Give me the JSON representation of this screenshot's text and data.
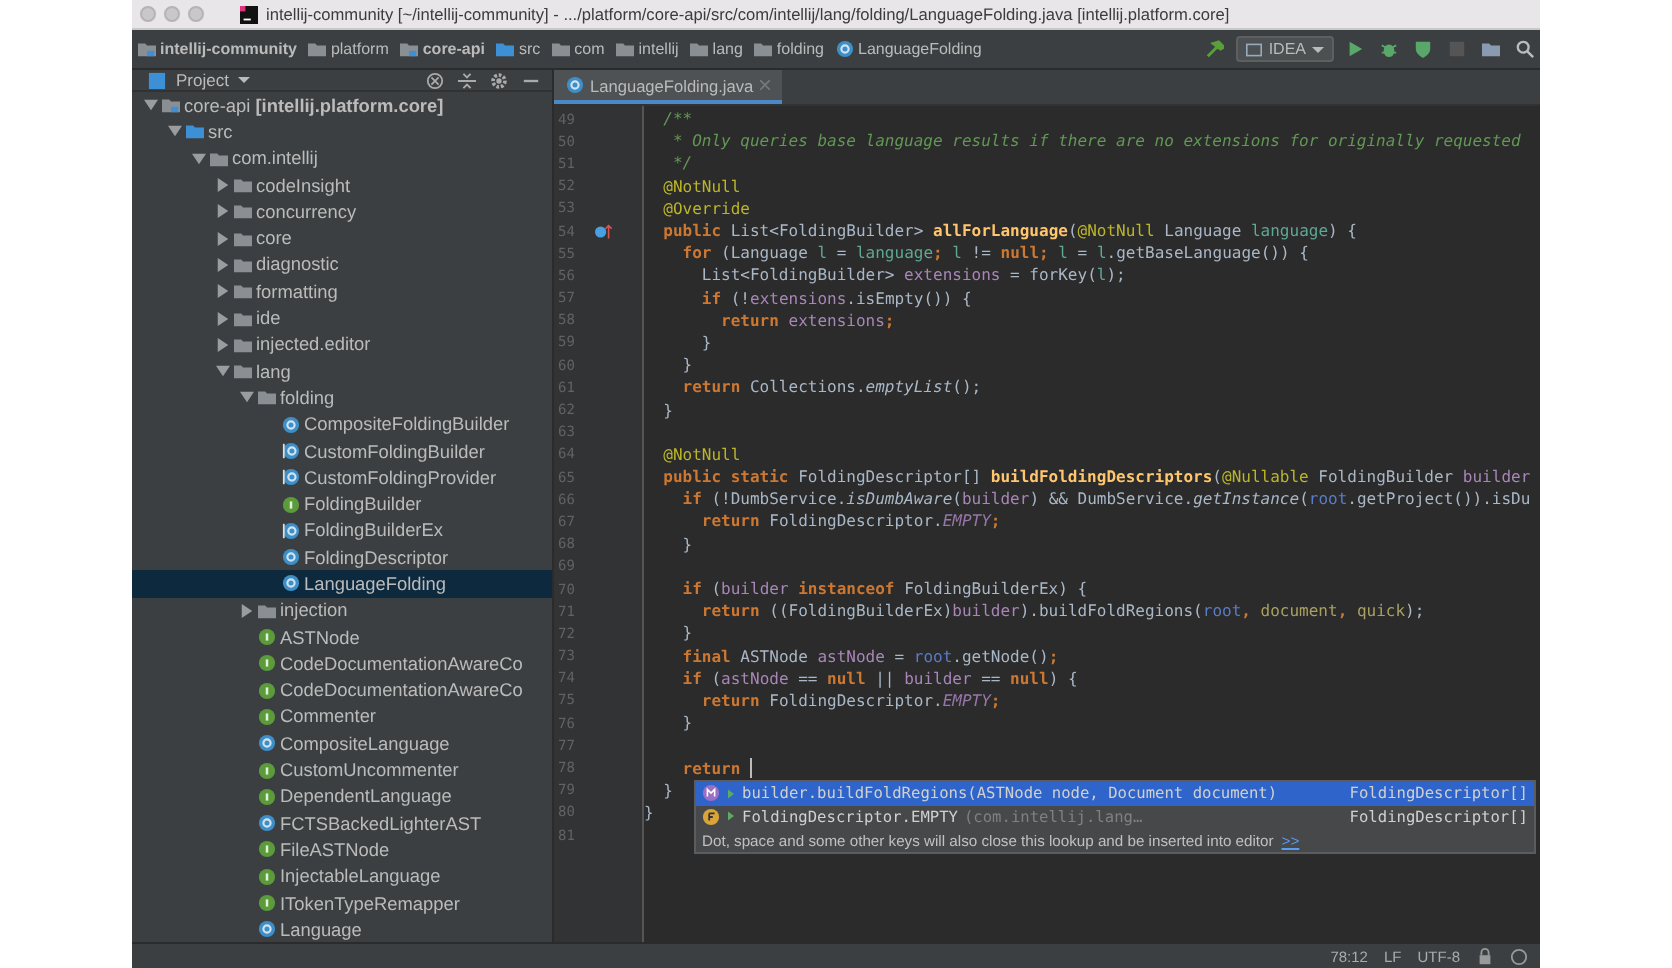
{
  "window": {
    "title": "intellij-community [~/intellij-community] - .../platform/core-api/src/com/intellij/lang/folding/LanguageFolding.java [intellij.platform.core]"
  },
  "breadcrumbs": [
    {
      "label": "intellij-community",
      "kind": "module"
    },
    {
      "label": "platform",
      "kind": "folder"
    },
    {
      "label": "core-api",
      "kind": "module"
    },
    {
      "label": "src",
      "kind": "source"
    },
    {
      "label": "com",
      "kind": "folder"
    },
    {
      "label": "intellij",
      "kind": "folder"
    },
    {
      "label": "lang",
      "kind": "folder"
    },
    {
      "label": "folding",
      "kind": "folder"
    },
    {
      "label": "LanguageFolding",
      "kind": "class"
    }
  ],
  "run_config": {
    "label": "IDEA"
  },
  "project_panel": {
    "title": "Project"
  },
  "tree": [
    {
      "label": "core-api **[intellij.platform.core]**",
      "kind": "module",
      "expanded": true,
      "selected": false,
      "children": [
        {
          "label": "src",
          "kind": "source",
          "expanded": true,
          "selected": false,
          "children": [
            {
              "label": "com.intellij",
              "kind": "folder",
              "expanded": true,
              "selected": false,
              "children": [
                {
                  "label": "codeInsight",
                  "kind": "folder",
                  "expanded": false,
                  "selected": false
                },
                {
                  "label": "concurrency",
                  "kind": "folder",
                  "expanded": false,
                  "selected": false
                },
                {
                  "label": "core",
                  "kind": "folder",
                  "expanded": false,
                  "selected": false
                },
                {
                  "label": "diagnostic",
                  "kind": "folder",
                  "expanded": false,
                  "selected": false
                },
                {
                  "label": "formatting",
                  "kind": "folder",
                  "expanded": false,
                  "selected": false
                },
                {
                  "label": "ide",
                  "kind": "folder",
                  "expanded": false,
                  "selected": false
                },
                {
                  "label": "injected.editor",
                  "kind": "folder",
                  "expanded": false,
                  "selected": false
                },
                {
                  "label": "lang",
                  "kind": "folder",
                  "expanded": true,
                  "selected": false,
                  "children": [
                    {
                      "label": "folding",
                      "kind": "folder",
                      "expanded": true,
                      "selected": false,
                      "children": [
                        {
                          "label": "CompositeFoldingBuilder",
                          "kind": "class",
                          "selected": false
                        },
                        {
                          "label": "CustomFoldingBuilder",
                          "kind": "abstract",
                          "selected": false
                        },
                        {
                          "label": "CustomFoldingProvider",
                          "kind": "abstract",
                          "selected": false
                        },
                        {
                          "label": "FoldingBuilder",
                          "kind": "interface",
                          "selected": false
                        },
                        {
                          "label": "FoldingBuilderEx",
                          "kind": "abstract",
                          "selected": false
                        },
                        {
                          "label": "FoldingDescriptor",
                          "kind": "class",
                          "selected": false
                        },
                        {
                          "label": "LanguageFolding",
                          "kind": "class",
                          "selected": true
                        }
                      ]
                    },
                    {
                      "label": "injection",
                      "kind": "folder",
                      "expanded": false,
                      "selected": false
                    },
                    {
                      "label": "ASTNode",
                      "kind": "interface",
                      "selected": false
                    },
                    {
                      "label": "CodeDocumentationAwareCo",
                      "kind": "interface",
                      "selected": false
                    },
                    {
                      "label": "CodeDocumentationAwareCo",
                      "kind": "interface",
                      "selected": false
                    },
                    {
                      "label": "Commenter",
                      "kind": "interface",
                      "selected": false
                    },
                    {
                      "label": "CompositeLanguage",
                      "kind": "class",
                      "selected": false
                    },
                    {
                      "label": "CustomUncommenter",
                      "kind": "interface",
                      "selected": false
                    },
                    {
                      "label": "DependentLanguage",
                      "kind": "interface",
                      "selected": false
                    },
                    {
                      "label": "FCTSBackedLighterAST",
                      "kind": "class",
                      "selected": false
                    },
                    {
                      "label": "FileASTNode",
                      "kind": "interface",
                      "selected": false
                    },
                    {
                      "label": "InjectableLanguage",
                      "kind": "interface",
                      "selected": false
                    },
                    {
                      "label": "ITokenTypeRemapper",
                      "kind": "interface",
                      "selected": false
                    },
                    {
                      "label": "Language",
                      "kind": "class",
                      "selected": false
                    }
                  ]
                }
              ]
            }
          ]
        }
      ]
    }
  ],
  "editor_tab": {
    "label": "LanguageFolding.java",
    "selected": true
  },
  "code": [
    {
      "n": "49",
      "segs": [
        {
          "kind": "cmt",
          "text": "  /**"
        }
      ]
    },
    {
      "n": "50",
      "segs": [
        {
          "kind": "cmt",
          "text": "   * Only queries base language results if there are no extensions for originally requested"
        }
      ]
    },
    {
      "n": "51",
      "segs": [
        {
          "kind": "cmt",
          "text": "   */"
        }
      ]
    },
    {
      "n": "52",
      "segs": [
        {
          "kind": "ann",
          "text": "  @NotNull"
        }
      ]
    },
    {
      "n": "53",
      "segs": [
        {
          "kind": "ann",
          "text": "  @Override"
        }
      ]
    },
    {
      "n": "54",
      "marker": {
        "kind": "override"
      },
      "segs": [
        {
          "kind": "kw",
          "text": "  public "
        },
        {
          "kind": "p",
          "text": "List<FoldingBuilder> "
        },
        {
          "kind": "fn",
          "text": "allForLanguage"
        },
        {
          "kind": "p",
          "text": "("
        },
        {
          "kind": "ann",
          "text": "@NotNull"
        },
        {
          "kind": "p",
          "text": " Language "
        },
        {
          "kind": "var",
          "text": "language"
        },
        {
          "kind": "p",
          "text": ") {"
        }
      ]
    },
    {
      "n": "55",
      "segs": [
        {
          "kind": "kw",
          "text": "    for "
        },
        {
          "kind": "p",
          "text": "(Language "
        },
        {
          "kind": "var",
          "text": "l"
        },
        {
          "kind": "p",
          "text": " = "
        },
        {
          "kind": "var",
          "text": "language"
        },
        {
          "kind": "kw",
          "text": "; "
        },
        {
          "kind": "var",
          "text": "l"
        },
        {
          "kind": "p",
          "text": " != "
        },
        {
          "kind": "kw",
          "text": "null; "
        },
        {
          "kind": "var",
          "text": "l"
        },
        {
          "kind": "p",
          "text": " = "
        },
        {
          "kind": "var",
          "text": "l"
        },
        {
          "kind": "p",
          "text": ".getBaseLanguage()) {"
        }
      ]
    },
    {
      "n": "56",
      "segs": [
        {
          "kind": "p",
          "text": "      List<FoldingBuilder> "
        },
        {
          "kind": "loc",
          "text": "extensions"
        },
        {
          "kind": "p",
          "text": " = forKey("
        },
        {
          "kind": "var",
          "text": "l"
        },
        {
          "kind": "p",
          "text": ");"
        }
      ]
    },
    {
      "n": "57",
      "segs": [
        {
          "kind": "kw",
          "text": "      if "
        },
        {
          "kind": "p",
          "text": "(!"
        },
        {
          "kind": "loc",
          "text": "extensions"
        },
        {
          "kind": "p",
          "text": ".isEmpty()) {"
        }
      ]
    },
    {
      "n": "58",
      "segs": [
        {
          "kind": "kw",
          "text": "        return "
        },
        {
          "kind": "loc",
          "text": "extensions"
        },
        {
          "kind": "kw",
          "text": ";"
        }
      ]
    },
    {
      "n": "59",
      "segs": [
        {
          "kind": "p",
          "text": "      }"
        }
      ]
    },
    {
      "n": "60",
      "segs": [
        {
          "kind": "p",
          "text": "    }"
        }
      ]
    },
    {
      "n": "61",
      "segs": [
        {
          "kind": "kw",
          "text": "    return "
        },
        {
          "kind": "p",
          "text": "Collections."
        },
        {
          "kind": "st",
          "text": "emptyList"
        },
        {
          "kind": "p",
          "text": "();"
        }
      ]
    },
    {
      "n": "62",
      "segs": [
        {
          "kind": "p",
          "text": "  }"
        }
      ]
    },
    {
      "n": "63"
    },
    {
      "n": "64",
      "segs": [
        {
          "kind": "ann",
          "text": "  @NotNull"
        }
      ]
    },
    {
      "n": "65",
      "segs": [
        {
          "kind": "kw",
          "text": "  public static "
        },
        {
          "kind": "p",
          "text": "FoldingDescriptor[] "
        },
        {
          "kind": "fn",
          "text": "buildFoldingDescriptors"
        },
        {
          "kind": "p",
          "text": "("
        },
        {
          "kind": "ann",
          "text": "@Nullable"
        },
        {
          "kind": "p",
          "text": " FoldingBuilder "
        },
        {
          "kind": "loc",
          "text": "builder"
        }
      ]
    },
    {
      "n": "66",
      "segs": [
        {
          "kind": "kw",
          "text": "    if "
        },
        {
          "kind": "p",
          "text": "(!DumbService."
        },
        {
          "kind": "st",
          "text": "isDumbAware"
        },
        {
          "kind": "p",
          "text": "("
        },
        {
          "kind": "loc",
          "text": "builder"
        },
        {
          "kind": "p",
          "text": ") && DumbService."
        },
        {
          "kind": "st",
          "text": "getInstance"
        },
        {
          "kind": "p",
          "text": "("
        },
        {
          "kind": "fld",
          "text": "root"
        },
        {
          "kind": "p",
          "text": ".getProject()).isDu"
        }
      ]
    },
    {
      "n": "67",
      "segs": [
        {
          "kind": "kw",
          "text": "      return "
        },
        {
          "kind": "p",
          "text": "FoldingDescriptor."
        },
        {
          "kind": "const",
          "text": "EMPTY"
        },
        {
          "kind": "kw",
          "text": ";"
        }
      ]
    },
    {
      "n": "68",
      "segs": [
        {
          "kind": "p",
          "text": "    }"
        }
      ]
    },
    {
      "n": "69"
    },
    {
      "n": "70",
      "segs": [
        {
          "kind": "kw",
          "text": "    if "
        },
        {
          "kind": "p",
          "text": "("
        },
        {
          "kind": "loc",
          "text": "builder"
        },
        {
          "kind": "kw",
          "text": " instanceof "
        },
        {
          "kind": "p",
          "text": "FoldingBuilderEx) {"
        }
      ]
    },
    {
      "n": "71",
      "segs": [
        {
          "kind": "kw",
          "text": "      return "
        },
        {
          "kind": "p",
          "text": "((FoldingBuilderEx)"
        },
        {
          "kind": "loc",
          "text": "builder"
        },
        {
          "kind": "p",
          "text": ").buildFoldRegions("
        },
        {
          "kind": "fld",
          "text": "root"
        },
        {
          "kind": "kw",
          "text": ", "
        },
        {
          "kind": "arg",
          "text": "document"
        },
        {
          "kind": "kw",
          "text": ", "
        },
        {
          "kind": "arg",
          "text": "quick"
        },
        {
          "kind": "p",
          "text": ");"
        }
      ]
    },
    {
      "n": "72",
      "segs": [
        {
          "kind": "p",
          "text": "    }"
        }
      ]
    },
    {
      "n": "73",
      "segs": [
        {
          "kind": "kw",
          "text": "    final "
        },
        {
          "kind": "p",
          "text": "ASTNode "
        },
        {
          "kind": "loc",
          "text": "astNode"
        },
        {
          "kind": "p",
          "text": " = "
        },
        {
          "kind": "fld",
          "text": "root"
        },
        {
          "kind": "p",
          "text": ".getNode()"
        },
        {
          "kind": "kw",
          "text": ";"
        }
      ]
    },
    {
      "n": "74",
      "segs": [
        {
          "kind": "kw",
          "text": "    if "
        },
        {
          "kind": "p",
          "text": "("
        },
        {
          "kind": "loc",
          "text": "astNode"
        },
        {
          "kind": "p",
          "text": " == "
        },
        {
          "kind": "kw",
          "text": "null"
        },
        {
          "kind": "p",
          "text": " || "
        },
        {
          "kind": "loc",
          "text": "builder"
        },
        {
          "kind": "p",
          "text": " == "
        },
        {
          "kind": "kw",
          "text": "null"
        },
        {
          "kind": "p",
          "text": ") {"
        }
      ]
    },
    {
      "n": "75",
      "segs": [
        {
          "kind": "kw",
          "text": "      return "
        },
        {
          "kind": "p",
          "text": "FoldingDescriptor."
        },
        {
          "kind": "const",
          "text": "EMPTY"
        },
        {
          "kind": "kw",
          "text": ";"
        }
      ]
    },
    {
      "n": "76",
      "segs": [
        {
          "kind": "p",
          "text": "    }"
        }
      ]
    },
    {
      "n": "77"
    },
    {
      "n": "78",
      "caret": true,
      "segs": [
        {
          "kind": "kw",
          "text": "    return "
        }
      ]
    },
    {
      "n": "79",
      "segs": [
        {
          "kind": "p",
          "text": "  }"
        }
      ]
    },
    {
      "n": "80",
      "segs": [
        {
          "kind": "p",
          "text": "}"
        }
      ]
    },
    {
      "n": "81"
    }
  ],
  "completion": {
    "items": [
      {
        "kind": "method",
        "text": "builder.buildFoldRegions(ASTNode node, Document document)",
        "type": "FoldingDescriptor[]",
        "selected": true
      },
      {
        "kind": "field",
        "text": "FoldingDescriptor.EMPTY",
        "hint": "(com.intellij.lang…",
        "type": "FoldingDescriptor[]",
        "selected": false
      }
    ],
    "footer": "Dot, space and some other keys will also close this lookup and be inserted into editor",
    "footer_link": ">>"
  },
  "status_bar": {
    "position": "78:12",
    "line_separator": "LF",
    "encoding": "UTF-8"
  }
}
